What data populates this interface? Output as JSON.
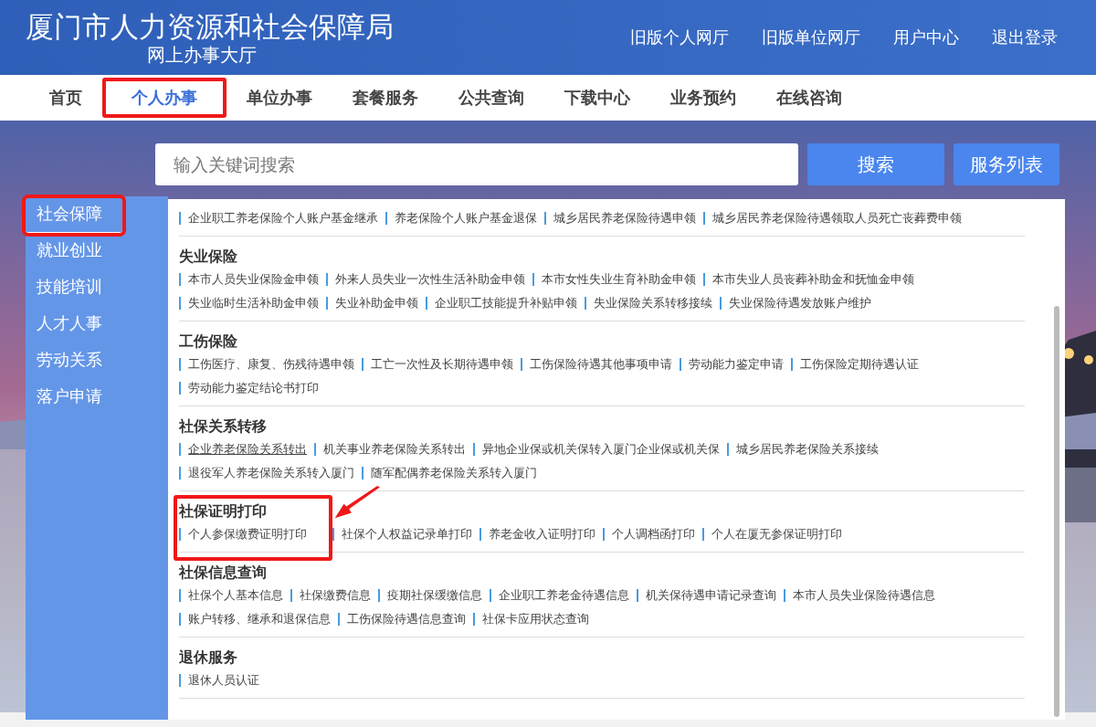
{
  "header": {
    "title": "厦门市人力资源和社会保障局",
    "subtitle": "网上办事大厅",
    "links": [
      "旧版个人网厅",
      "旧版单位网厅",
      "用户中心",
      "退出登录"
    ]
  },
  "nav": [
    {
      "label": "首页",
      "selected": false,
      "callout": false
    },
    {
      "label": "个人办事",
      "selected": true,
      "callout": true
    },
    {
      "label": "单位办事",
      "selected": false,
      "callout": false
    },
    {
      "label": "套餐服务",
      "selected": false,
      "callout": false
    },
    {
      "label": "公共查询",
      "selected": false,
      "callout": false
    },
    {
      "label": "下载中心",
      "selected": false,
      "callout": false
    },
    {
      "label": "业务预约",
      "selected": false,
      "callout": false
    },
    {
      "label": "在线咨询",
      "selected": false,
      "callout": false
    }
  ],
  "search": {
    "placeholder": "输入关键词搜索",
    "button": "搜索",
    "list_button": "服务列表"
  },
  "sidebar": [
    {
      "label": "社会保障",
      "selected": true,
      "callout": true
    },
    {
      "label": "就业创业",
      "selected": false,
      "callout": false
    },
    {
      "label": "技能培训",
      "selected": false,
      "callout": false
    },
    {
      "label": "人才人事",
      "selected": false,
      "callout": false
    },
    {
      "label": "劳动关系",
      "selected": false,
      "callout": false
    },
    {
      "label": "落户申请",
      "selected": false,
      "callout": false
    }
  ],
  "sections": [
    {
      "callout": false,
      "lines": [
        {
          "links": [
            {
              "text": "企业职工养老保险个人账户基金继承",
              "underlined": false
            },
            {
              "text": "养老保险个人账户基金退保",
              "underlined": false
            },
            {
              "text": "城乡居民养老保险待遇申领",
              "underlined": false
            },
            {
              "text": "城乡居民养老保险待遇领取人员死亡丧葬费申领",
              "underlined": false
            }
          ]
        }
      ]
    },
    {
      "title": "失业保险",
      "callout": false,
      "lines": [
        {
          "links": [
            {
              "text": "本市人员失业保险金申领",
              "underlined": false
            },
            {
              "text": "外来人员失业一次性生活补助金申领",
              "underlined": false
            },
            {
              "text": "本市女性失业生育补助金申领",
              "underlined": false
            },
            {
              "text": "本市失业人员丧葬补助金和抚恤金申领",
              "underlined": false
            }
          ]
        },
        {
          "links": [
            {
              "text": "失业临时生活补助金申领",
              "underlined": false
            },
            {
              "text": "失业补助金申领",
              "underlined": false
            },
            {
              "text": "企业职工技能提升补贴申领",
              "underlined": false
            },
            {
              "text": "失业保险关系转移接续",
              "underlined": false
            },
            {
              "text": "失业保险待遇发放账户维护",
              "underlined": false
            }
          ]
        }
      ]
    },
    {
      "title": "工伤保险",
      "callout": false,
      "lines": [
        {
          "links": [
            {
              "text": "工伤医疗、康复、伤残待遇申领",
              "underlined": false
            },
            {
              "text": "工亡一次性及长期待遇申领",
              "underlined": false
            },
            {
              "text": "工伤保险待遇其他事项申请",
              "underlined": false
            },
            {
              "text": "劳动能力鉴定申请",
              "underlined": false
            },
            {
              "text": "工伤保险定期待遇认证",
              "underlined": false
            }
          ]
        },
        {
          "links": [
            {
              "text": "劳动能力鉴定结论书打印",
              "underlined": false
            }
          ]
        }
      ]
    },
    {
      "title": "社保关系转移",
      "callout": false,
      "lines": [
        {
          "links": [
            {
              "text": "企业养老保险关系转出",
              "underlined": true
            },
            {
              "text": "机关事业养老保险关系转出",
              "underlined": false
            },
            {
              "text": "异地企业保或机关保转入厦门企业保或机关保",
              "underlined": false
            },
            {
              "text": "城乡居民养老保险关系接续",
              "underlined": false
            }
          ]
        },
        {
          "links": [
            {
              "text": "退役军人养老保险关系转入厦门",
              "underlined": false
            },
            {
              "text": "随军配偶养老保险关系转入厦门",
              "underlined": false
            }
          ]
        }
      ]
    },
    {
      "title": "社保证明打印",
      "callout": true,
      "lines": [
        {
          "links": [
            {
              "text": "个人参保缴费证明打印",
              "underlined": false
            },
            {
              "text": "社保个人权益记录单打印",
              "underlined": false
            },
            {
              "text": "养老金收入证明打印",
              "underlined": false
            },
            {
              "text": "个人调档函打印",
              "underlined": false
            },
            {
              "text": "个人在厦无参保证明打印",
              "underlined": false
            }
          ]
        }
      ]
    },
    {
      "title": "社保信息查询",
      "callout": false,
      "lines": [
        {
          "links": [
            {
              "text": "社保个人基本信息",
              "underlined": false
            },
            {
              "text": "社保缴费信息",
              "underlined": false
            },
            {
              "text": "疫期社保缓缴信息",
              "underlined": false
            },
            {
              "text": "企业职工养老金待遇信息",
              "underlined": false
            },
            {
              "text": "机关保待遇申请记录查询",
              "underlined": false
            },
            {
              "text": "本市人员失业保险待遇信息",
              "underlined": false
            }
          ]
        },
        {
          "links": [
            {
              "text": "账户转移、继承和退保信息",
              "underlined": false
            },
            {
              "text": "工伤保险待遇信息查询",
              "underlined": false
            },
            {
              "text": "社保卡应用状态查询",
              "underlined": false
            }
          ]
        }
      ]
    },
    {
      "title": "退休服务",
      "callout": false,
      "lines": [
        {
          "links": [
            {
              "text": "退休人员认证",
              "underlined": false
            }
          ]
        }
      ]
    }
  ]
}
